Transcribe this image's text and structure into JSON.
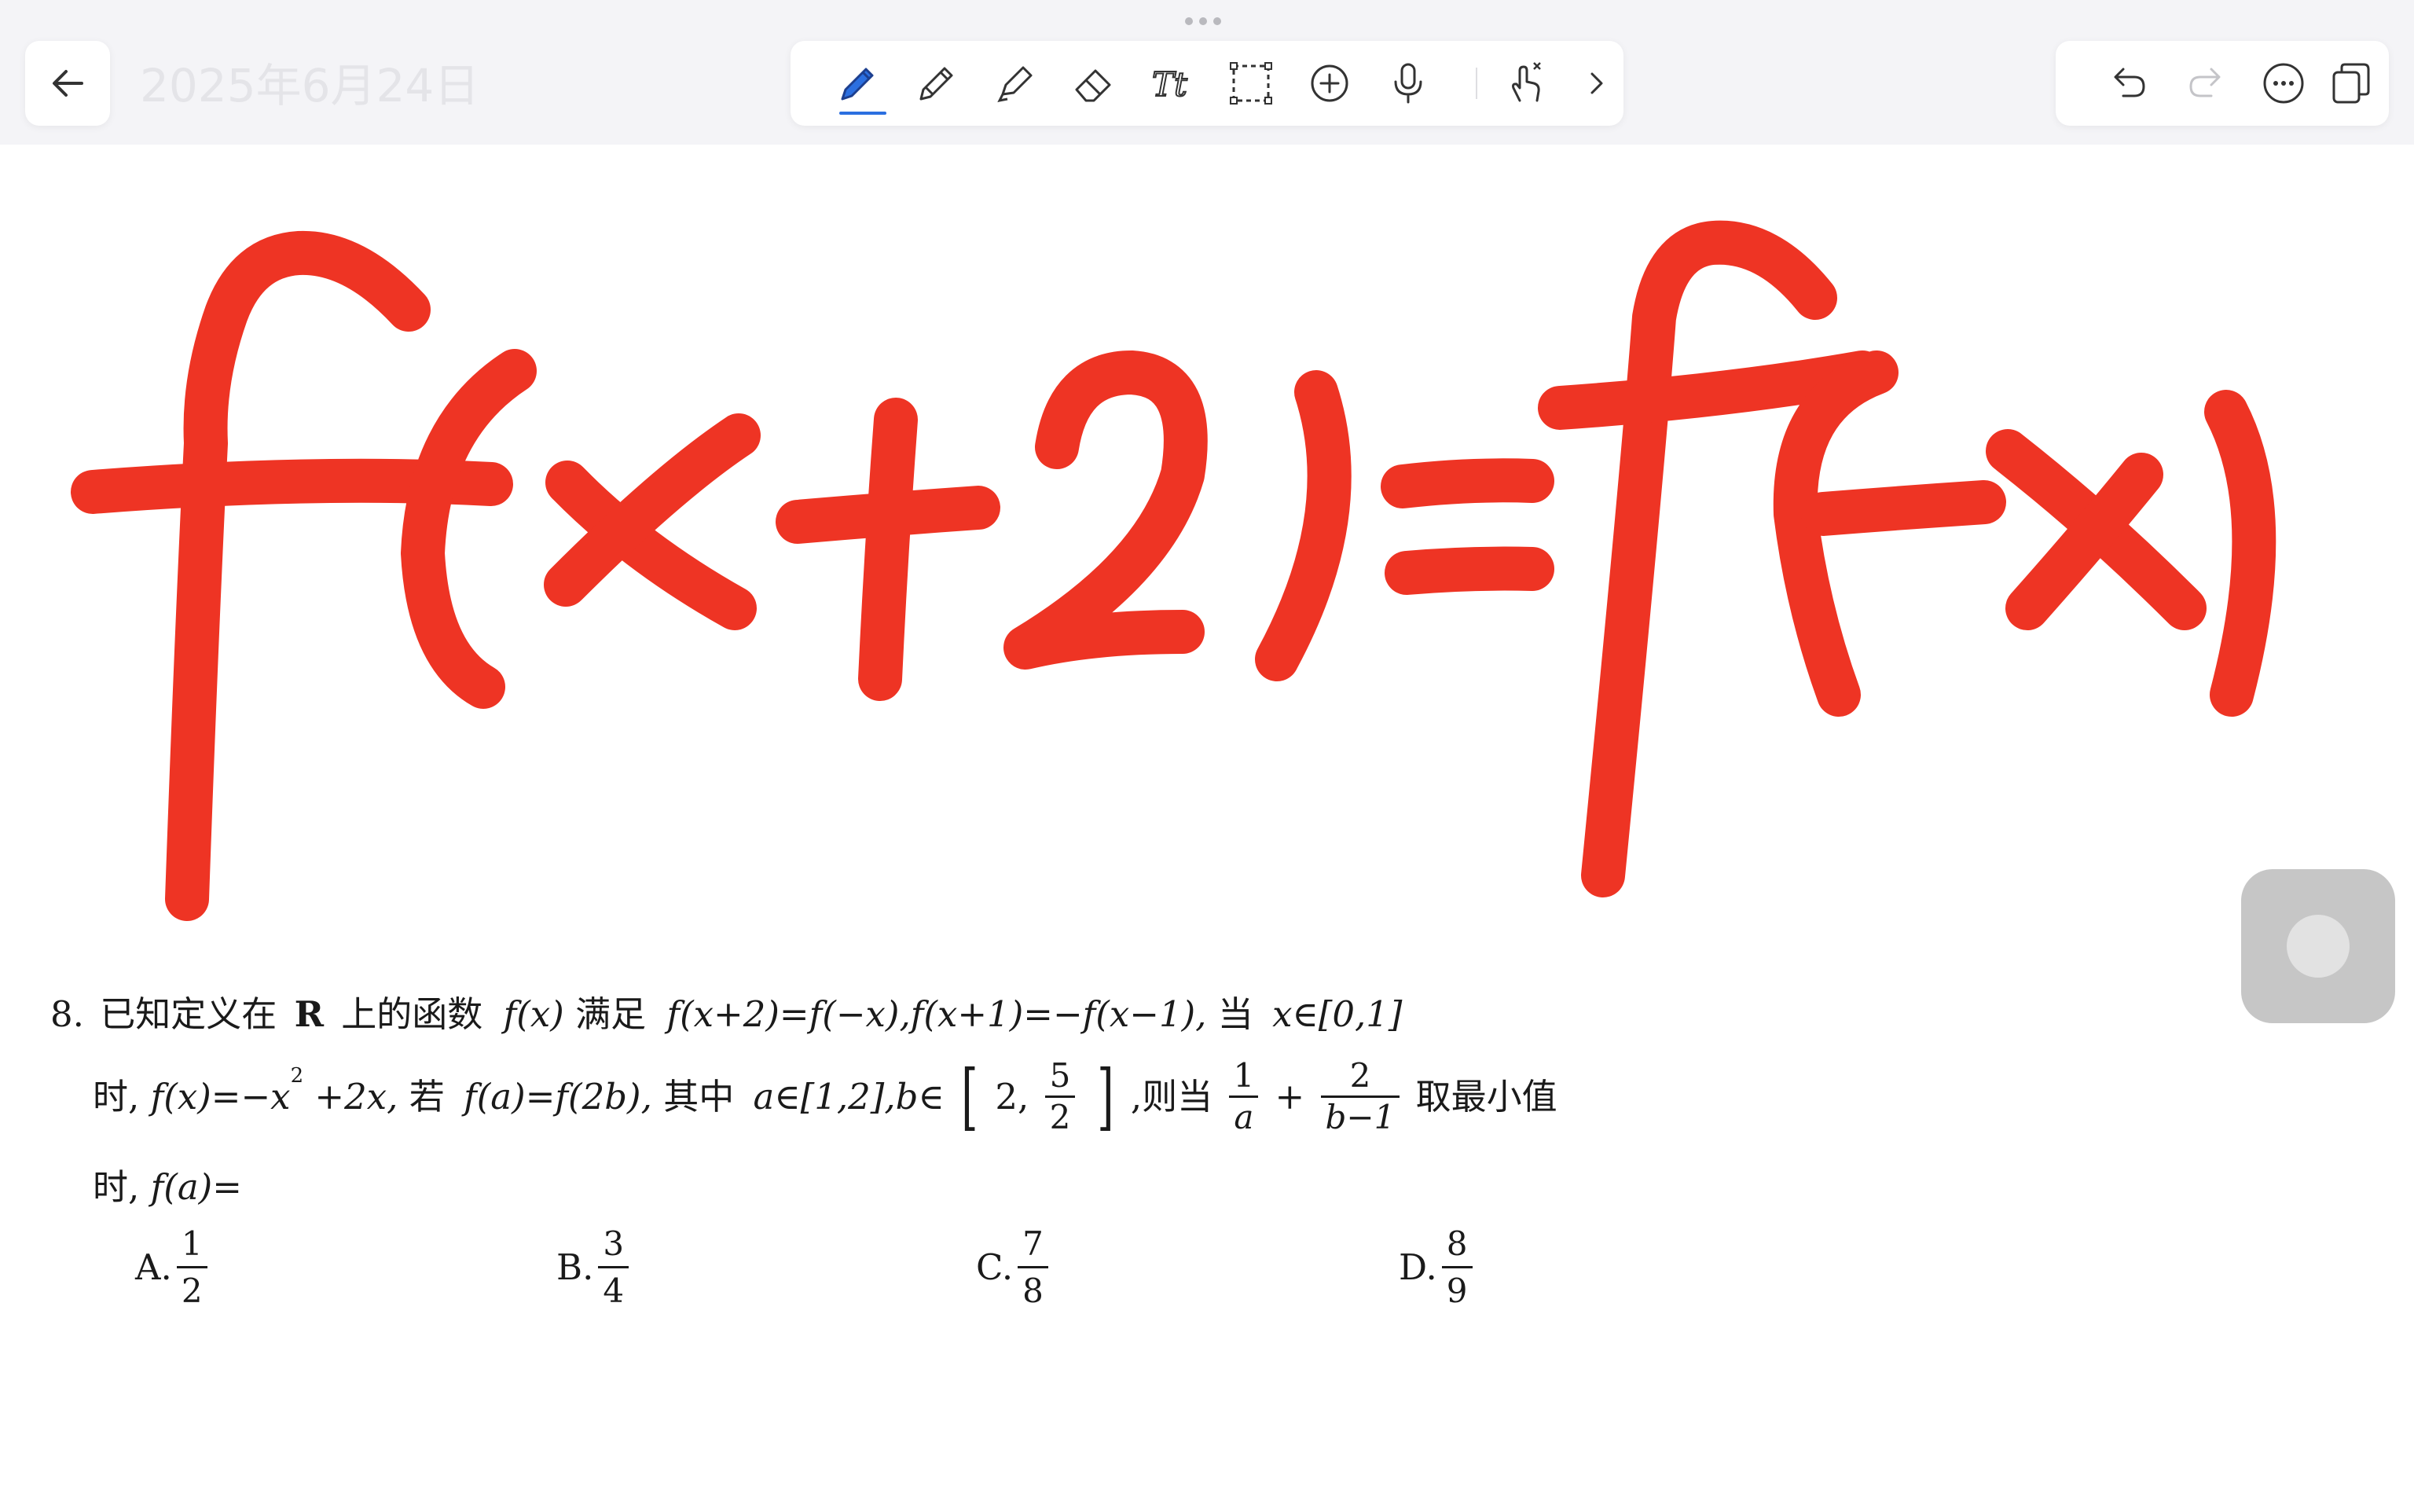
{
  "header": {
    "date_title": "2025年6月24日"
  },
  "toolbar": {
    "accent_color": "#2b6fe0",
    "tools": [
      "pen-icon",
      "pencil-icon",
      "highlighter-icon",
      "eraser-icon",
      "text-icon",
      "lasso-select-icon",
      "add-icon",
      "microphone-icon",
      "touch-gesture-icon",
      "chevron-right-icon"
    ],
    "right_tools": [
      "undo-icon",
      "redo-icon",
      "more-icon",
      "pages-icon"
    ]
  },
  "handwriting": {
    "text": "f(x+2)=f(-x)",
    "color": "#ee3424"
  },
  "problem": {
    "number": "8.",
    "line1": {
      "a": "已知定义在",
      "b": "R",
      "c": "上的函数",
      "d": "f(x)",
      "e": "满足",
      "f": "f(x+2)=f(−x),f(x+1)=−f(x−1),",
      "g": "当",
      "h": "x∈[0,1]"
    },
    "line2": {
      "a": "时,",
      "b": "f(x)=−x",
      "sup": "2",
      "c": "+2x,",
      "d": "若",
      "e": "f(a)=f(2b),",
      "f": "其中",
      "g": "a∈[1,2],b∈",
      "bracket_open": "[",
      "interval_start": "2,",
      "frac_num": "5",
      "frac_den": "2",
      "bracket_close": "]",
      "h": ",则当",
      "frac1_num": "1",
      "frac1_den": "a",
      "plus": "+",
      "frac2_num": "2",
      "frac2_den": "b−1",
      "i": "取最小值"
    },
    "line3": {
      "a": "时,",
      "b": "f(a)="
    },
    "options": [
      {
        "label": "A.",
        "num": "1",
        "den": "2"
      },
      {
        "label": "B.",
        "num": "3",
        "den": "4"
      },
      {
        "label": "C.",
        "num": "7",
        "den": "8"
      },
      {
        "label": "D.",
        "num": "8",
        "den": "9"
      }
    ]
  }
}
